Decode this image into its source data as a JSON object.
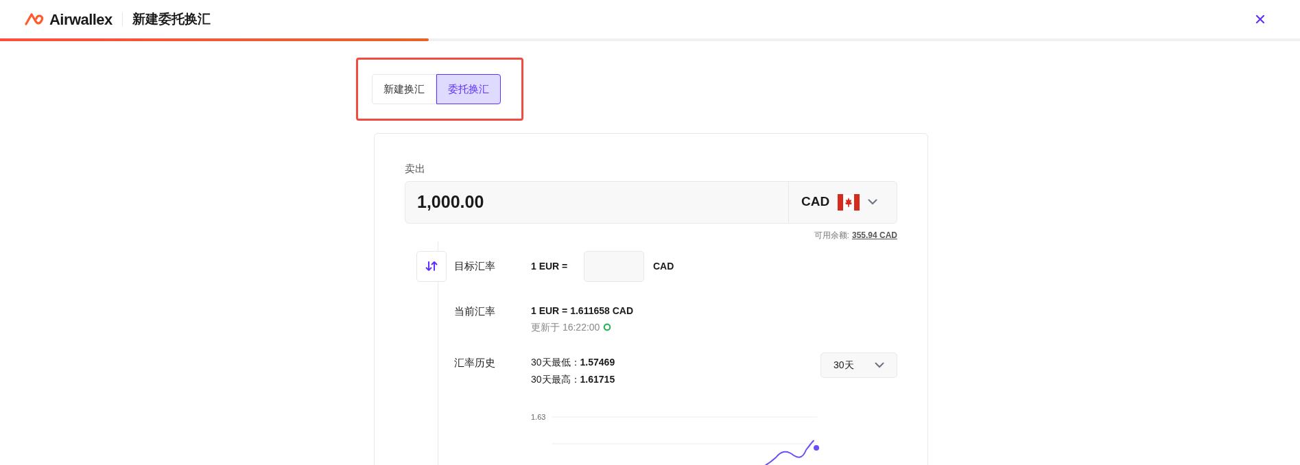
{
  "header": {
    "logo_text": "Airwallex",
    "title": "新建委托换汇",
    "progress": {
      "level": 0.33
    }
  },
  "tabs": [
    {
      "label": "新建换汇",
      "selected": false
    },
    {
      "label": "委托换汇",
      "selected": true
    }
  ],
  "sell": {
    "label": "卖出",
    "amount": "1,000.00",
    "currency": "CAD",
    "balance_label": "可用余额:",
    "balance_value": "355.94 CAD"
  },
  "target_rate": {
    "label": "目标汇率",
    "prefix": "1 EUR =",
    "suffix": "CAD"
  },
  "current_rate": {
    "label": "当前汇率",
    "value": "1 EUR = 1.611658 CAD",
    "updated": "更新于 16:22:00"
  },
  "history": {
    "label": "汇率历史",
    "low_label": "30天最低：",
    "low_value": "1.57469",
    "high_label": "30天最高：",
    "high_value": "1.61715",
    "period": "30天",
    "chart": {
      "tick_label": "1.63"
    }
  }
}
